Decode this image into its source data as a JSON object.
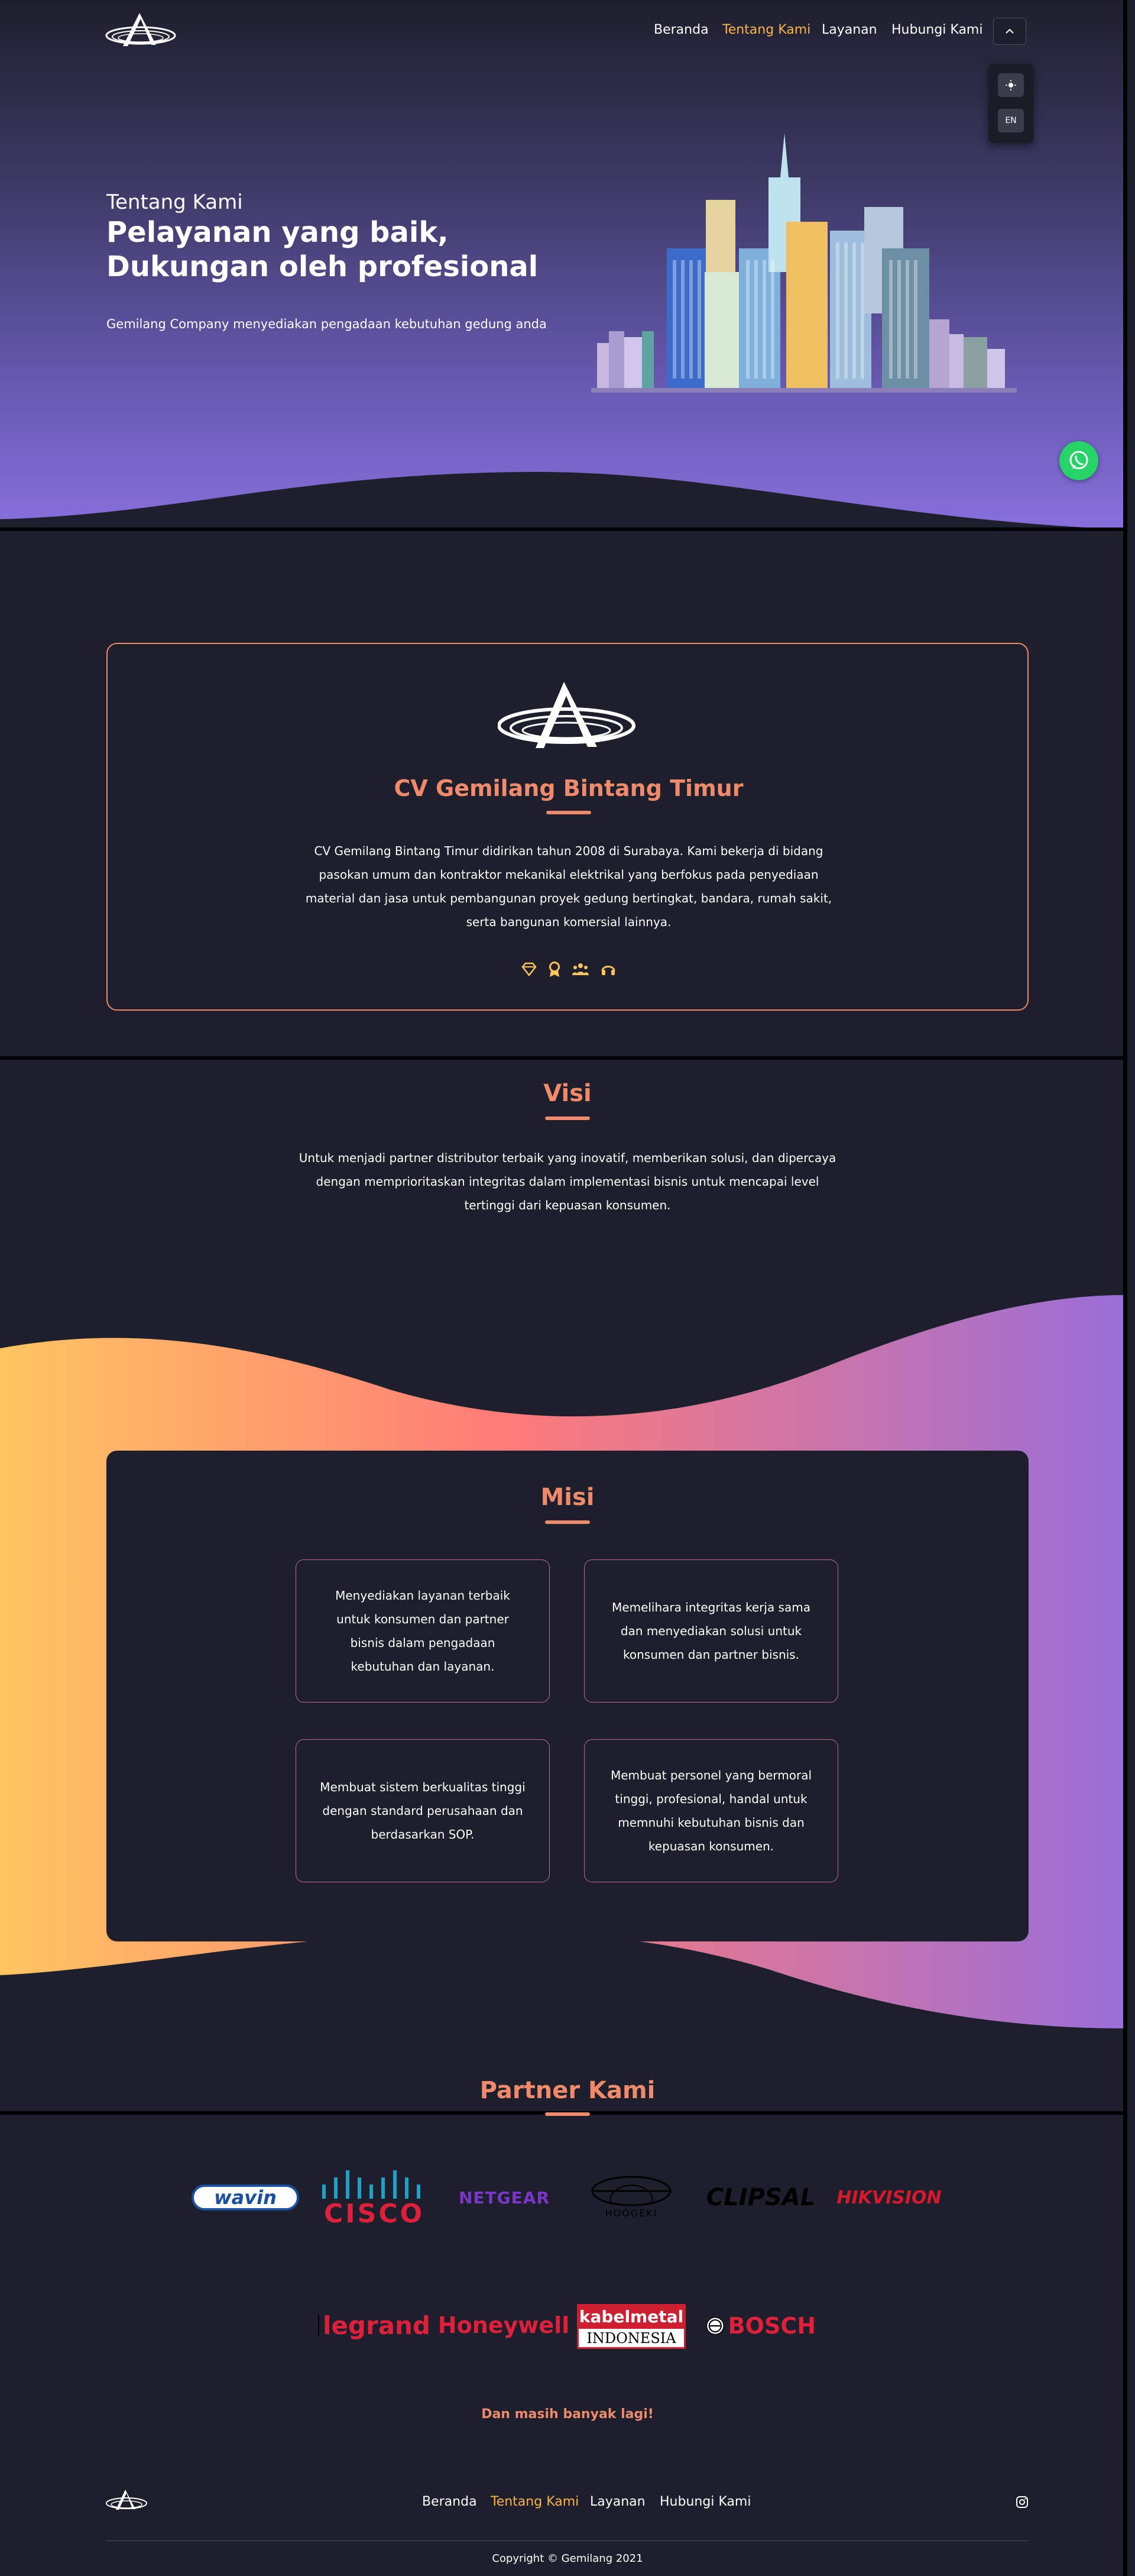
{
  "nav": {
    "items": [
      {
        "label": "Beranda",
        "active": false
      },
      {
        "label": "Tentang Kami",
        "active": true
      },
      {
        "label": "Layanan",
        "active": false
      },
      {
        "label": "Hubungi Kami",
        "active": false
      }
    ],
    "toggle_icon": "chevron-up-icon",
    "dropdown": {
      "theme_icon": "sun-icon",
      "language": "EN"
    }
  },
  "hero": {
    "subtitle": "Tentang Kami",
    "title": "Pelayanan yang baik, Dukungan oleh profesional",
    "description": "Gemilang Company menyediakan pengadaan kebutuhan gedung anda"
  },
  "whatsapp_icon": "whatsapp-icon",
  "company": {
    "name": "CV Gemilang Bintang Timur",
    "description": "CV Gemilang Bintang Timur didirikan tahun 2008 di Surabaya. Kami bekerja di bidang pasokan umum dan kontraktor mekanikal elektrikal yang berfokus pada penyediaan material dan jasa untuk pembangunan proyek gedung bertingkat, bandara, rumah sakit, serta bangunan komersial lainnya.",
    "icons": [
      "diamond-icon",
      "award-icon",
      "team-icon",
      "headset-icon"
    ]
  },
  "visi": {
    "title": "Visi",
    "text": "Untuk menjadi partner distributor terbaik yang inovatif, memberikan solusi, dan dipercaya dengan memprioritaskan integritas dalam implementasi bisnis untuk mencapai level tertinggi dari kepuasan konsumen."
  },
  "misi": {
    "title": "Misi",
    "items": [
      "Menyediakan layanan terbaik untuk konsumen dan partner bisnis dalam pengadaan kebutuhan dan layanan.",
      "Memelihara integritas kerja sama dan menyediakan solusi untuk konsumen dan partner bisnis.",
      "Membuat sistem berkualitas tinggi dengan standard perusahaan dan berdasarkan SOP.",
      "Membuat personel yang bermoral tinggi, profesional, handal untuk memnuhi kebutuhan bisnis dan kepuasan konsumen."
    ]
  },
  "partners": {
    "title": "Partner Kami",
    "logos": [
      "wavin",
      "CISCO",
      "NETGEAR",
      "HOOGEKI",
      "CLIPSAL",
      "HIKVISION",
      "legrand",
      "Honeywell",
      "kabelmetal",
      "INDONESIA",
      "BOSCH"
    ],
    "more": "Dan masih banyak lagi!"
  },
  "footer": {
    "nav": [
      "Beranda",
      "Tentang Kami",
      "Layanan",
      "Hubungi Kami"
    ],
    "active_index": 1,
    "social_icon": "instagram-icon",
    "copyright": "Copyright © Gemilang 2021"
  },
  "colors": {
    "accent": "#f08a6a",
    "nav_active": "#ffb347",
    "background": "#1d1f2c",
    "whatsapp": "#25d366"
  }
}
